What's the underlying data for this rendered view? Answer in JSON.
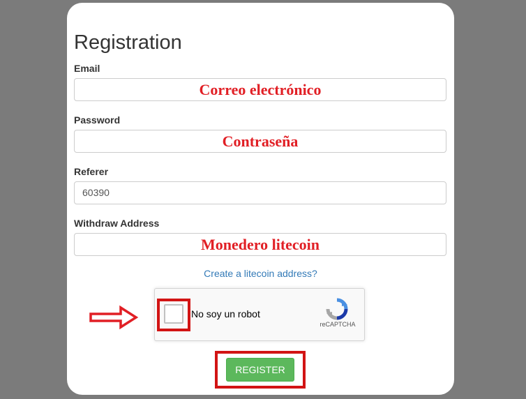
{
  "form": {
    "title": "Registration",
    "fields": {
      "email": {
        "label": "Email",
        "annotation": "Correo electrónico",
        "value": ""
      },
      "password": {
        "label": "Password",
        "annotation": "Contraseña",
        "value": ""
      },
      "referer": {
        "label": "Referer",
        "value": "60390"
      },
      "withdraw": {
        "label": "Withdraw Address",
        "annotation": "Monedero litecoin",
        "value": ""
      }
    },
    "create_link": "Create a litecoin address?",
    "captcha": {
      "label": "No soy un robot",
      "brand": "reCAPTCHA",
      "checked": false
    },
    "register_label": "REGISTER"
  },
  "colors": {
    "background": "#7b7b7b",
    "annotation_red": "#e11f25",
    "highlight_red": "#d21414",
    "button_green": "#5cb85c",
    "link_blue": "#337ab7"
  },
  "icons": {
    "captcha_logo": "recaptcha-logo-icon",
    "arrow": "right-arrow-icon"
  }
}
